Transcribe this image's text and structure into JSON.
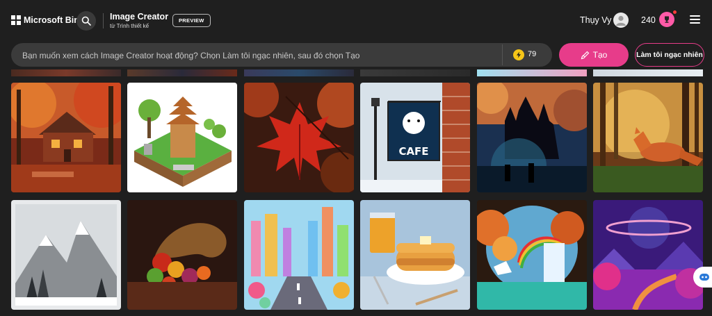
{
  "header": {
    "brand": "Microsoft Bing",
    "app_title": "Image Creator",
    "app_subtitle": "từ Trình thiết kế",
    "preview_badge": "PREVIEW",
    "user_name": "Thụy Vy",
    "rewards_count": "240"
  },
  "prompt": {
    "placeholder": "Bạn muốn xem cách Image Creator hoạt động? Chọn Làm tôi ngạc nhiên, sau đó chọn Tạo",
    "boosts_count": "79",
    "create_label": "Tạo",
    "surprise_label": "Làm tôi ngạc nhiên"
  },
  "gallery": {
    "images": [
      {
        "name": "autumn-cabin-image",
        "subject": "red cabin in autumn forest"
      },
      {
        "name": "isometric-pagoda-image",
        "subject": "isometric pagoda island"
      },
      {
        "name": "red-maple-leaf-image",
        "subject": "red maple leaf"
      },
      {
        "name": "cafe-sign-image",
        "subject": "polar bear cafe sign",
        "text": "CAFE"
      },
      {
        "name": "dark-castle-image",
        "subject": "dark gothic castle"
      },
      {
        "name": "fox-forest-image",
        "subject": "fox in sunlit forest"
      },
      {
        "name": "snowy-mountains-stamp-image",
        "subject": "snowy mountains stamp"
      },
      {
        "name": "cornucopia-image",
        "subject": "cornucopia of fruits"
      },
      {
        "name": "candy-city-image",
        "subject": "colorful candy city"
      },
      {
        "name": "pancakes-image",
        "subject": "pancakes with orange juice"
      },
      {
        "name": "rainbow-waterfall-image",
        "subject": "waterfall with rainbow and unicorn"
      },
      {
        "name": "purple-planet-landscape-image",
        "subject": "purple planet landscape"
      }
    ]
  },
  "colors": {
    "accent": "#e73c8a",
    "background": "#1f1f1f",
    "prompt_bg": "#3b3b3b"
  }
}
